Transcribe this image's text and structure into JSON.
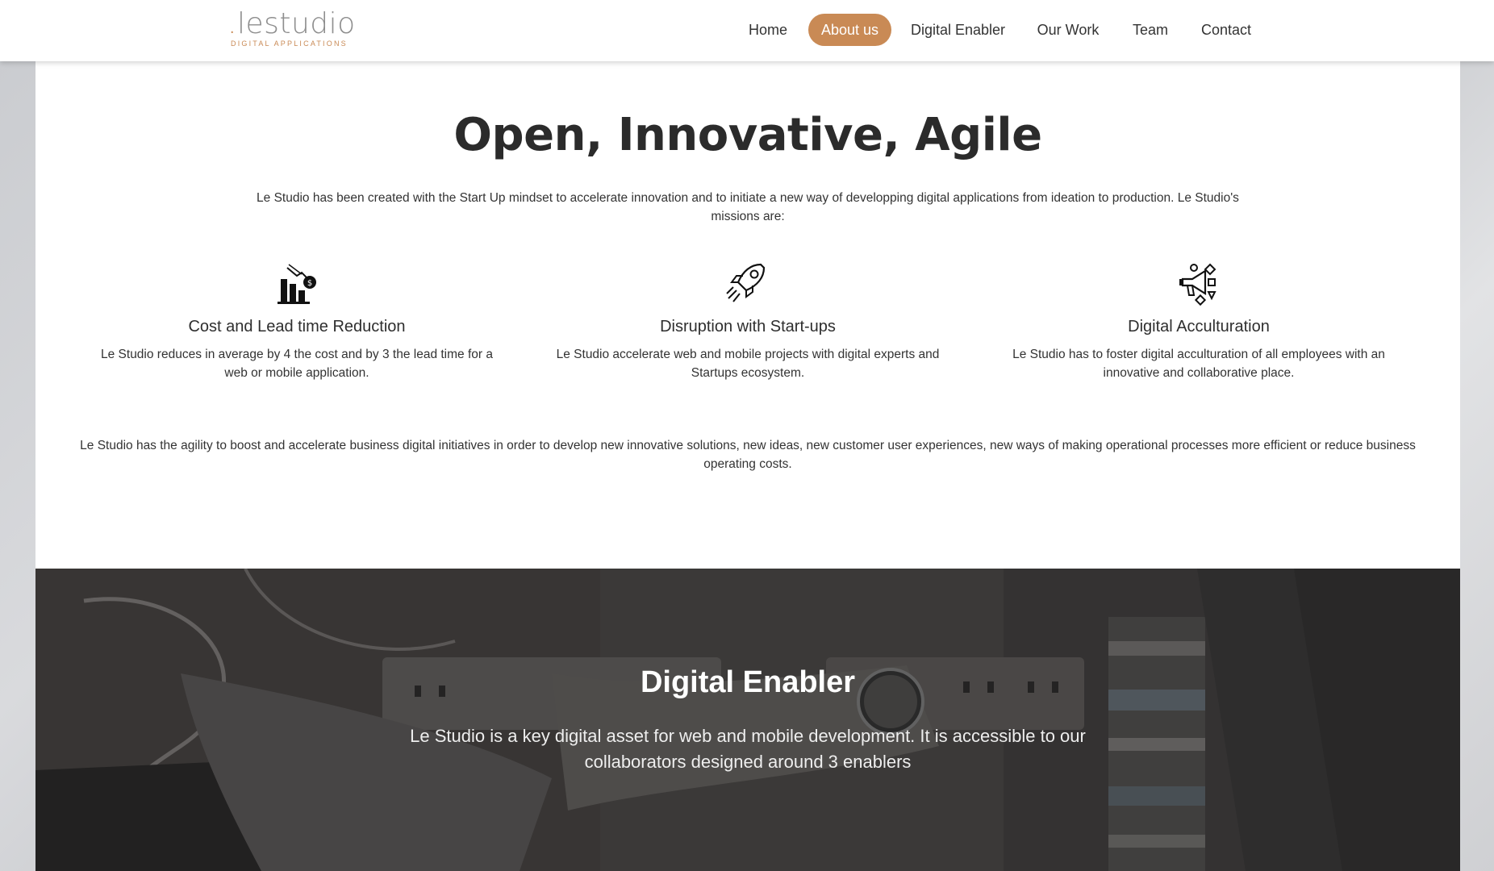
{
  "header": {
    "logo": {
      "text": "lestudio",
      "dot": ".",
      "subtitle": "DIGITAL APPLICATIONS"
    },
    "nav": [
      {
        "label": "Home",
        "active": false
      },
      {
        "label": "About us",
        "active": true
      },
      {
        "label": "Digital Enabler",
        "active": false
      },
      {
        "label": "Our Work",
        "active": false
      },
      {
        "label": "Team",
        "active": false
      },
      {
        "label": "Contact",
        "active": false
      }
    ],
    "accent_color": "#c98a55"
  },
  "about": {
    "title": "Open, Innovative, Agile",
    "intro": "Le Studio has been created with the Start Up mindset to accelerate innovation and to initiate a new way of developping digital applications from ideation to production. Le Studio's missions are:",
    "missions": [
      {
        "icon": "chart-down-icon",
        "title": "Cost and Lead time Reduction",
        "text": "Le Studio reduces in average by 4 the cost and by 3 the lead time for a web or mobile application."
      },
      {
        "icon": "rocket-icon",
        "title": "Disruption with Start-ups",
        "text": "Le Studio accelerate web and mobile projects with digital experts and Startups ecosystem."
      },
      {
        "icon": "megaphone-icon",
        "title": "Digital Acculturation",
        "text": "Le Studio has to foster digital acculturation of all employees with an innovative and collaborative place."
      }
    ],
    "outro": "Le Studio has the agility to boost and accelerate business digital initiatives in order to develop new innovative solutions, new ideas, new customer user experiences, new ways of making operational processes more efficient or reduce business operating costs."
  },
  "enabler": {
    "title": "Digital Enabler",
    "text": "Le Studio is a key digital asset for web and mobile development. It is accessible to our collaborators designed around 3 enablers"
  }
}
